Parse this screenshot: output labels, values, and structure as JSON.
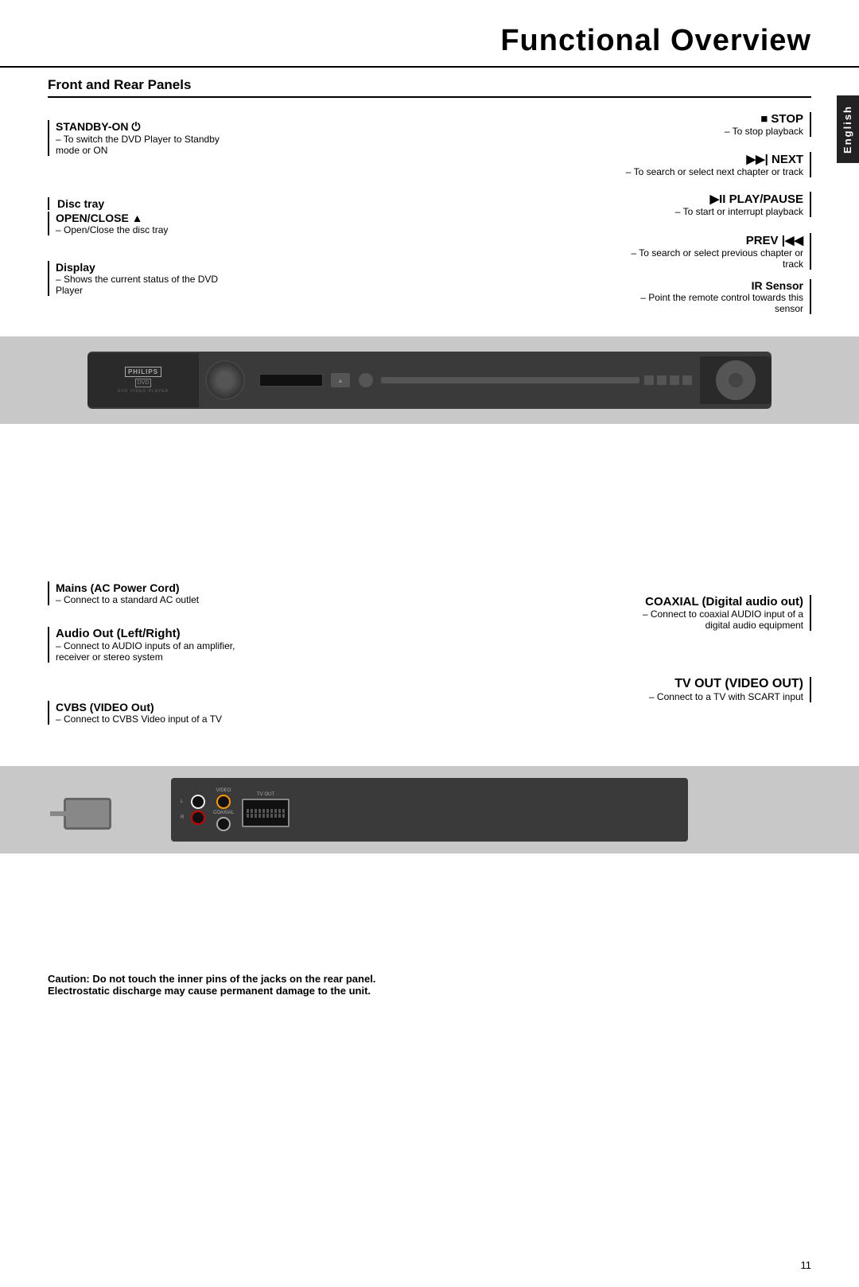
{
  "page": {
    "title": "Functional Overview",
    "section_title": "Front and Rear Panels",
    "sidebar_label": "English",
    "page_number": "11"
  },
  "front_panel": {
    "labels_left": {
      "standby": {
        "title": "STANDBY-ON ⏻",
        "desc1": "–  To switch the DVD Player to Standby",
        "desc2": "mode or ON"
      },
      "disc_tray": {
        "title": "Disc tray"
      },
      "open_close": {
        "title": "OPEN/CLOSE ▲",
        "desc1": "–  Open/Close the disc tray"
      },
      "display": {
        "title": "Display",
        "desc1": "–  Shows the current status of the DVD",
        "desc2": "Player"
      }
    },
    "labels_right": {
      "stop": {
        "title": "■  STOP",
        "desc1": "– To stop playback"
      },
      "next": {
        "title": "▶▶|  NEXT",
        "desc1": "– To search or select next chapter or track"
      },
      "play_pause": {
        "title": "▶II PLAY/PAUSE",
        "desc1": "– To start or interrupt playback"
      },
      "prev": {
        "title": "PREV |◀◀",
        "desc1": "– To search or select previous chapter or",
        "desc2": "track"
      },
      "ir_sensor": {
        "title": "IR Sensor",
        "desc1": "– Point the remote control towards this",
        "desc2": "sensor"
      }
    }
  },
  "rear_panel": {
    "labels_left": {
      "mains": {
        "title": "Mains (AC Power Cord)",
        "desc1": "–  Connect to a standard AC outlet"
      },
      "audio_out": {
        "title": "Audio Out (Left/Right)",
        "desc1": "–  Connect to AUDIO inputs of an amplifier,",
        "desc2": "receiver or stereo system"
      },
      "cvbs": {
        "title": "CVBS (VIDEO Out)",
        "desc1": "–  Connect to CVBS Video input of a TV"
      }
    },
    "labels_right": {
      "coaxial": {
        "title": "COAXIAL (Digital audio out)",
        "desc1": "– Connect to coaxial AUDIO input of a",
        "desc2": "digital audio equipment"
      },
      "tv_out": {
        "title": "TV OUT (VIDEO OUT)",
        "desc1": "– Connect to a TV with SCART input"
      }
    }
  },
  "caution": {
    "line1": "Caution: Do not touch the inner pins of the jacks on the rear panel.",
    "line2": "Electrostatic discharge may cause permanent damage to the unit."
  },
  "device": {
    "brand": "PHILIPS",
    "model": "DVD",
    "label": "DVD VIDEO PLAYER"
  }
}
